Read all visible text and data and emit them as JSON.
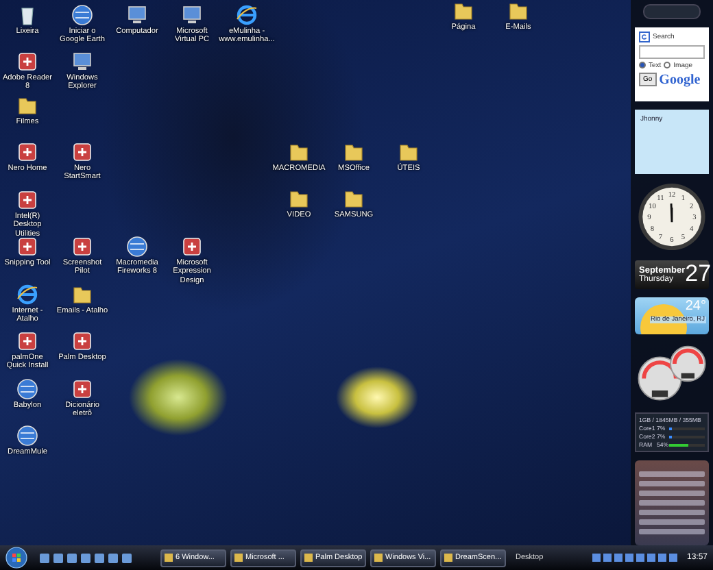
{
  "desktop_icons": [
    {
      "label": "Lixeira",
      "kind": "bin"
    },
    {
      "label": "Iniciar o Google Earth",
      "kind": "globe"
    },
    {
      "label": "Computador",
      "kind": "monitor"
    },
    {
      "label": "Microsoft Virtual PC",
      "kind": "monitor"
    },
    {
      "label": "eMulinha - www.emulinha...",
      "kind": "browser"
    },
    {
      "label": "Página",
      "kind": "folder"
    },
    {
      "label": "E-Mails",
      "kind": "folder"
    },
    {
      "label": "Adobe Reader 8",
      "kind": "app"
    },
    {
      "label": "Windows Explorer",
      "kind": "monitor"
    },
    {
      "label": "Filmes",
      "kind": "folder"
    },
    {
      "label": "Nero Home",
      "kind": "app"
    },
    {
      "label": "Nero StartSmart",
      "kind": "app"
    },
    {
      "label": "MACROMEDIA",
      "kind": "folder"
    },
    {
      "label": "MSOffice",
      "kind": "folder"
    },
    {
      "label": "ÚTEIS",
      "kind": "folder"
    },
    {
      "label": "Intel(R) Desktop Utilities",
      "kind": "app"
    },
    {
      "label": "VIDEO",
      "kind": "folder"
    },
    {
      "label": "SAMSUNG",
      "kind": "folder"
    },
    {
      "label": "Snipping Tool",
      "kind": "app"
    },
    {
      "label": "Screenshot Pilot",
      "kind": "app"
    },
    {
      "label": "Macromedia Fireworks 8",
      "kind": "globe"
    },
    {
      "label": "Microsoft Expression Design",
      "kind": "app"
    },
    {
      "label": "Internet - Atalho",
      "kind": "browser"
    },
    {
      "label": "Emails - Atalho",
      "kind": "folder"
    },
    {
      "label": "palmOne Quick Install",
      "kind": "app"
    },
    {
      "label": "Palm Desktop",
      "kind": "app"
    },
    {
      "label": "Babylon",
      "kind": "globe"
    },
    {
      "label": "Dicionário eletrô",
      "kind": "app"
    },
    {
      "label": "DreamMule",
      "kind": "globe"
    }
  ],
  "sidebar": {
    "search_gadget": {
      "label": "Search",
      "options": [
        {
          "label": "Text",
          "selected": true
        },
        {
          "label": "Image",
          "selected": false
        }
      ],
      "button": "Go",
      "logo": "Google"
    },
    "note": {
      "text": "Jhonny"
    },
    "clock": {
      "numerals": [
        "12",
        "11",
        "1",
        "10",
        "2",
        "9",
        "3",
        "8",
        "4",
        "7",
        "5",
        "6"
      ]
    },
    "calendar": {
      "month": "September",
      "weekday": "Thursday",
      "day": "27"
    },
    "weather": {
      "temperature": "24°",
      "city": "Rio de Janeiro, RJ"
    },
    "system_stats": {
      "header": "1GB / 1845MB / 355MB",
      "rows": [
        {
          "label": "Core1",
          "reading": "7%",
          "level": 0.07
        },
        {
          "label": "Core2",
          "reading": "7%",
          "level": 0.07
        },
        {
          "label": "RAM",
          "reading": "54%",
          "level": 0.54
        }
      ]
    }
  },
  "taskbar": {
    "tasks": [
      {
        "label": "6 Window..."
      },
      {
        "label": "Microsoft ..."
      },
      {
        "label": "Palm Desktop"
      },
      {
        "label": "Windows Vi..."
      },
      {
        "label": "DreamScen..."
      }
    ],
    "toolbar_label": "Desktop",
    "time": "13:57"
  }
}
